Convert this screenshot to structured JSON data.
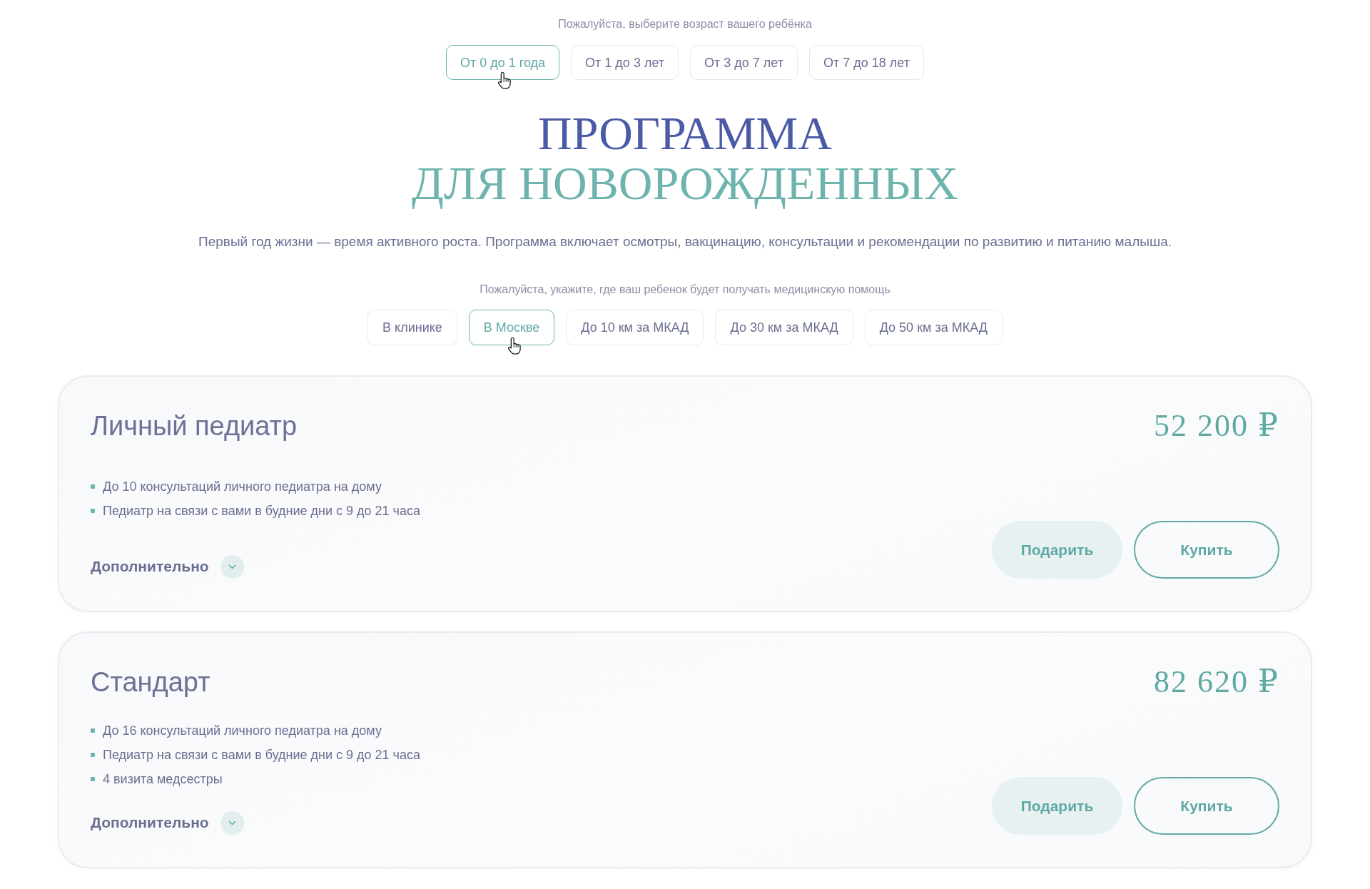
{
  "age_selector": {
    "prompt": "Пожалуйста, выберите возраст вашего ребёнка",
    "options": [
      {
        "label": "От 0 до 1 года",
        "selected": true
      },
      {
        "label": "От 1 до 3 лет",
        "selected": false
      },
      {
        "label": "От 3 до 7 лет",
        "selected": false
      },
      {
        "label": "От 7 до 18 лет",
        "selected": false
      }
    ]
  },
  "heading": {
    "line_1": "ПРОГРАММА",
    "line_2": "ДЛЯ НОВОРОЖДЕННЫХ"
  },
  "description": "Первый год жизни — время активного роста. Программа включает осмотры, вакцинацию, консультации и рекомендации по развитию и питанию малыша.",
  "location_selector": {
    "prompt": "Пожалуйста, укажите, где ваш ребенок будет получать медицинскую помощь",
    "options": [
      {
        "label": "В клинике",
        "selected": false
      },
      {
        "label": "В Москве",
        "selected": true
      },
      {
        "label": "До 10 км за МКАД",
        "selected": false
      },
      {
        "label": "До 30 км за МКАД",
        "selected": false
      },
      {
        "label": "До 50 км за МКАД",
        "selected": false
      }
    ]
  },
  "plans": [
    {
      "title": "Личный педиатр",
      "price": "52 200 ₽",
      "features": [
        "До 10 консультаций личного педиатра на дому",
        "Педиатр на связи с вами в будние дни с 9 до 21 часа"
      ],
      "more_label": "Дополнительно",
      "expanded": false,
      "buttons": [
        {
          "label": "Подарить",
          "kind": "soft"
        },
        {
          "label": "Купить",
          "kind": "outline"
        }
      ]
    },
    {
      "title": "Стандарт",
      "price": "82 620 ₽",
      "features": [
        "До 16 консультаций личного педиатра на дому",
        "Педиатр на связи с вами в будние дни с 9 до 21 часа",
        "4 визита медсестры"
      ],
      "more_label": "Дополнительно",
      "expanded": false,
      "buttons": [
        {
          "label": "Подарить",
          "kind": "soft"
        },
        {
          "label": "Купить",
          "kind": "outline"
        }
      ]
    }
  ]
}
